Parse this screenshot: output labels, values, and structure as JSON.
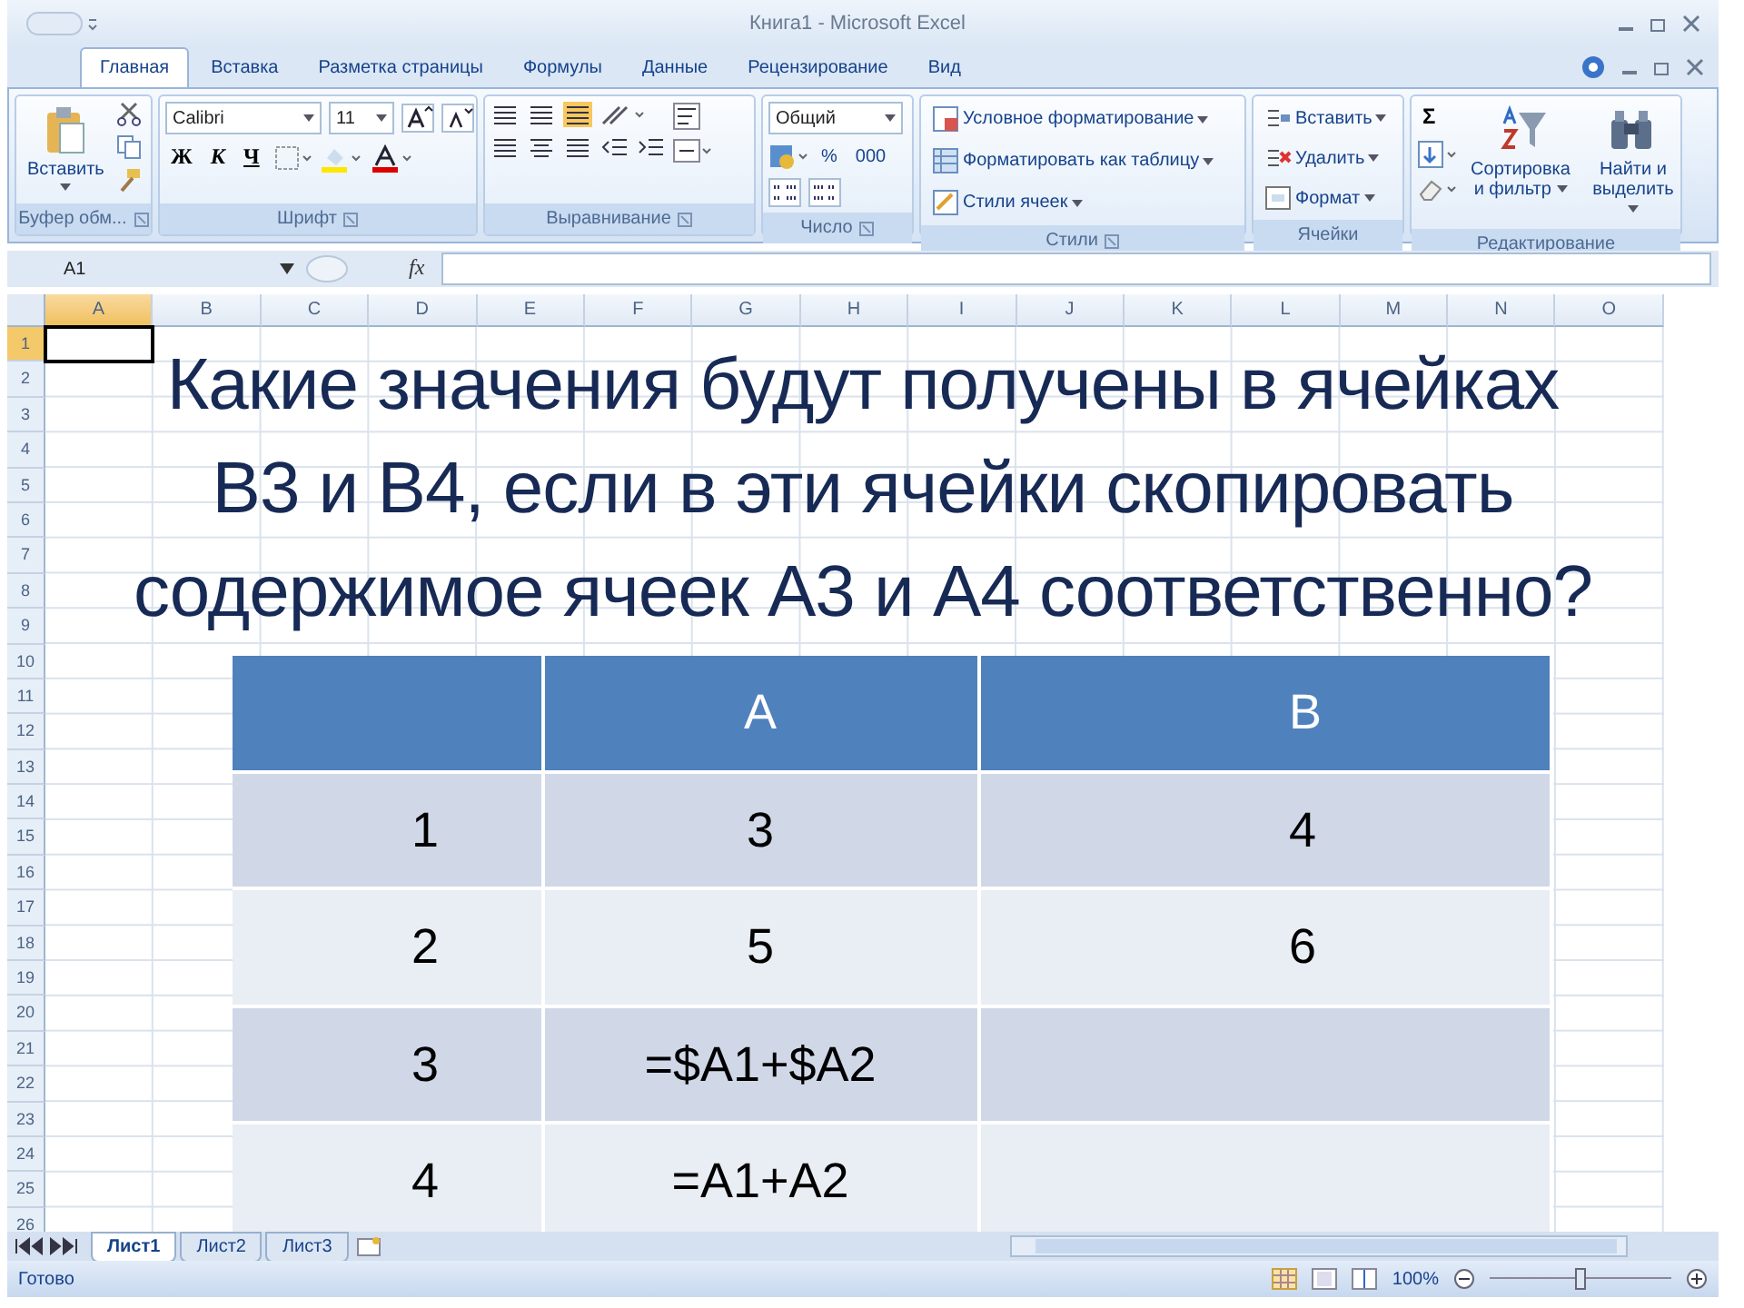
{
  "window": {
    "title": "Книга1 - Microsoft Excel"
  },
  "ribbon_tabs": [
    {
      "label": "Главная",
      "selected": true
    },
    {
      "label": "Вставка",
      "selected": false
    },
    {
      "label": "Разметка страницы",
      "selected": false
    },
    {
      "label": "Формулы",
      "selected": false
    },
    {
      "label": "Данные",
      "selected": false
    },
    {
      "label": "Рецензирование",
      "selected": false
    },
    {
      "label": "Вид",
      "selected": false
    }
  ],
  "clipboard": {
    "paste": "Вставить",
    "label": "Буфер обм..."
  },
  "font": {
    "name": "Calibri",
    "size": "11",
    "bold": "Ж",
    "italic": "К",
    "underline": "Ч",
    "label": "Шрифт"
  },
  "alignment": {
    "label": "Выравнивание"
  },
  "number": {
    "format": "Общий",
    "percent": "%",
    "thousands": "000",
    "label": "Число"
  },
  "styles": {
    "items": [
      "Условное форматирование",
      "Форматировать как таблицу",
      "Стили ячеек"
    ],
    "label": "Стили"
  },
  "cells": {
    "items": [
      "Вставить",
      "Удалить",
      "Формат"
    ],
    "label": "Ячейки"
  },
  "editing": {
    "sum": "Σ",
    "sort": "Сортировка и фильтр",
    "find": "Найти и выделить",
    "label": "Редактирование"
  },
  "formula_bar": {
    "name_box": "A1",
    "fx": "fx"
  },
  "columns": [
    {
      "label": "A",
      "selected": true
    },
    {
      "label": "B",
      "selected": false
    },
    {
      "label": "C",
      "selected": false
    },
    {
      "label": "D",
      "selected": false
    },
    {
      "label": "E",
      "selected": false
    },
    {
      "label": "F",
      "selected": false
    },
    {
      "label": "G",
      "selected": false
    },
    {
      "label": "H",
      "selected": false
    },
    {
      "label": "I",
      "selected": false
    },
    {
      "label": "J",
      "selected": false
    },
    {
      "label": "K",
      "selected": false
    },
    {
      "label": "L",
      "selected": false
    },
    {
      "label": "M",
      "selected": false
    },
    {
      "label": "N",
      "selected": false
    },
    {
      "label": "O",
      "selected": false
    }
  ],
  "rows": [
    {
      "label": "1",
      "selected": true
    },
    {
      "label": "2",
      "selected": false
    },
    {
      "label": "3",
      "selected": false
    },
    {
      "label": "4",
      "selected": false
    },
    {
      "label": "5",
      "selected": false
    },
    {
      "label": "6",
      "selected": false
    },
    {
      "label": "7",
      "selected": false
    },
    {
      "label": "8",
      "selected": false
    },
    {
      "label": "9",
      "selected": false
    },
    {
      "label": "10",
      "selected": false
    },
    {
      "label": "11",
      "selected": false
    },
    {
      "label": "12",
      "selected": false
    },
    {
      "label": "13",
      "selected": false
    },
    {
      "label": "14",
      "selected": false
    },
    {
      "label": "15",
      "selected": false
    },
    {
      "label": "16",
      "selected": false
    },
    {
      "label": "17",
      "selected": false
    },
    {
      "label": "18",
      "selected": false
    },
    {
      "label": "19",
      "selected": false
    },
    {
      "label": "20",
      "selected": false
    },
    {
      "label": "21",
      "selected": false
    },
    {
      "label": "22",
      "selected": false
    },
    {
      "label": "23",
      "selected": false
    },
    {
      "label": "24",
      "selected": false
    },
    {
      "label": "25",
      "selected": false
    },
    {
      "label": "26",
      "selected": false
    }
  ],
  "question": "Какие значения будут получены в ячейках\nB3 и B4, если в эти ячейки скопировать\nсодержимое ячеек A3 и A4 соответственно?",
  "table": {
    "columns": [
      "",
      "A",
      "B"
    ],
    "rows": [
      [
        "1",
        "3",
        "4"
      ],
      [
        "2",
        "5",
        "6"
      ],
      [
        "3",
        "=$A1+$A2",
        ""
      ],
      [
        "4",
        "=A1+A2",
        ""
      ]
    ]
  },
  "sheet_tabs": [
    {
      "label": "Лист1",
      "selected": true
    },
    {
      "label": "Лист2",
      "selected": false
    },
    {
      "label": "Лист3",
      "selected": false
    }
  ],
  "status_bar": {
    "text": "Готово",
    "zoom": "100%",
    "level": 0.5
  }
}
